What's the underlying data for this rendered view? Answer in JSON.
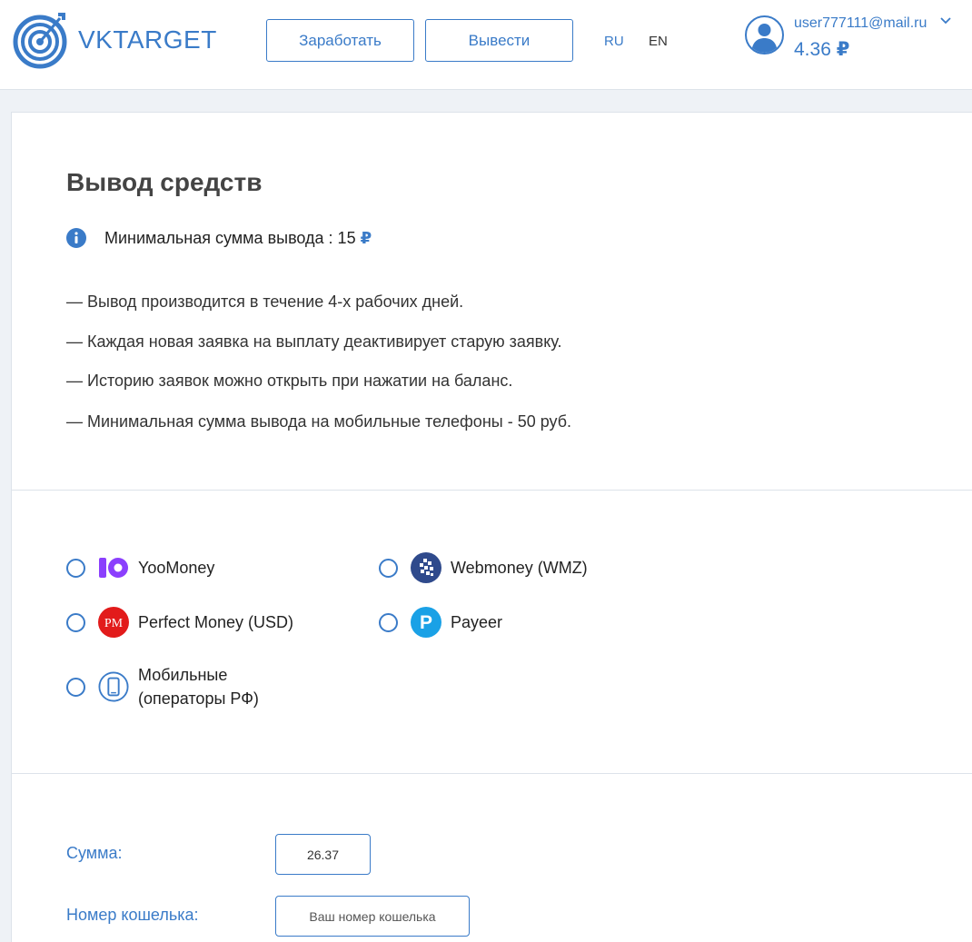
{
  "header": {
    "logo_text": "VKTARGET",
    "nav": {
      "earn_label": "Заработать",
      "withdraw_label": "Вывести"
    },
    "lang": {
      "ru": "RU",
      "en": "EN"
    },
    "user": {
      "email": "user777111@mail.ru",
      "balance": "4.36",
      "currency": "₽"
    }
  },
  "page": {
    "title": "Вывод средств",
    "min_withdraw": {
      "label": "Минимальная сумма вывода : 15",
      "currency": "₽"
    },
    "rules": [
      "— Вывод производится в течение 4-х рабочих дней.",
      "— Каждая новая заявка на выплату деактивирует старую заявку.",
      "— Историю заявок можно открыть при нажатии на баланс.",
      "— Минимальная сумма вывода на мобильные телефоны - 50 руб."
    ],
    "payment_methods": [
      {
        "label": "YooMoney",
        "icon": "yoomoney-icon",
        "color": "#8b3ffd"
      },
      {
        "label": "Webmoney (WMZ)",
        "icon": "webmoney-icon",
        "color": "#2f4a8c"
      },
      {
        "label": "Perfect Money (USD)",
        "icon": "perfect-money-icon",
        "icon_text": "PM",
        "color": "#e21b1b"
      },
      {
        "label": "Payeer",
        "icon": "payeer-icon",
        "icon_text": "P",
        "color": "#1aa1e6"
      },
      {
        "label": "Мобильные",
        "label2": "(операторы РФ)",
        "icon": "mobile-phone-icon",
        "color": "#3a7bc8"
      }
    ],
    "form": {
      "amount_label": "Сумма:",
      "amount_value": "26.37",
      "wallet_label": "Номер кошелька:",
      "wallet_placeholder": "Ваш номер кошелька"
    }
  },
  "colors": {
    "accent": "#3a7bc8",
    "background": "#eef2f6",
    "card": "#ffffff"
  }
}
